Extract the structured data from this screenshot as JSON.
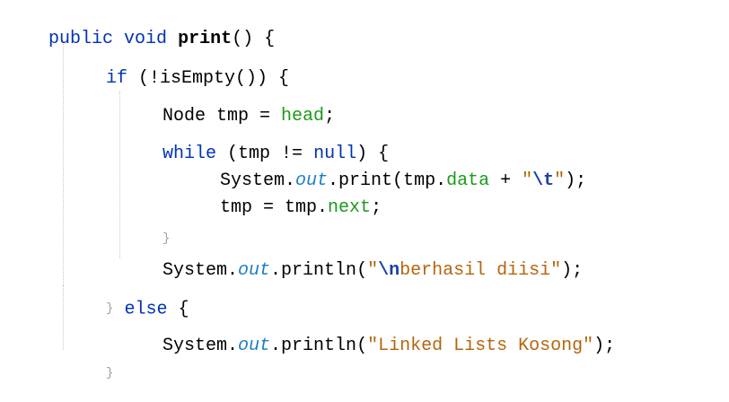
{
  "code": {
    "kw_public": "public",
    "kw_void": "void",
    "method_name": "print",
    "paren_open_brace": "() {",
    "kw_if": "if",
    "cond_if": " (!isEmpty()) {",
    "node_decl": "Node tmp = ",
    "head_field": "head",
    "semicolon": ";",
    "kw_while": "while",
    "while_cond_a": " (tmp != ",
    "kw_null": "null",
    "while_cond_b": ") {",
    "system": "System.",
    "out_field": "out",
    "print_call": ".print(tmp.",
    "data_field": "data",
    "plus_quote": " + ",
    "escape_t": "\\t",
    "close_print": ");",
    "assign_tmp": "tmp = tmp.",
    "next_field": "next",
    "println_call": ".println(",
    "escape_n": "\\n",
    "str_berhasil": "berhasil diisi",
    "else_a": "} ",
    "kw_else": "else",
    "else_b": " {",
    "str_linked": "Linked Lists Kosong",
    "quote": "\"",
    "brace_small": "}"
  }
}
